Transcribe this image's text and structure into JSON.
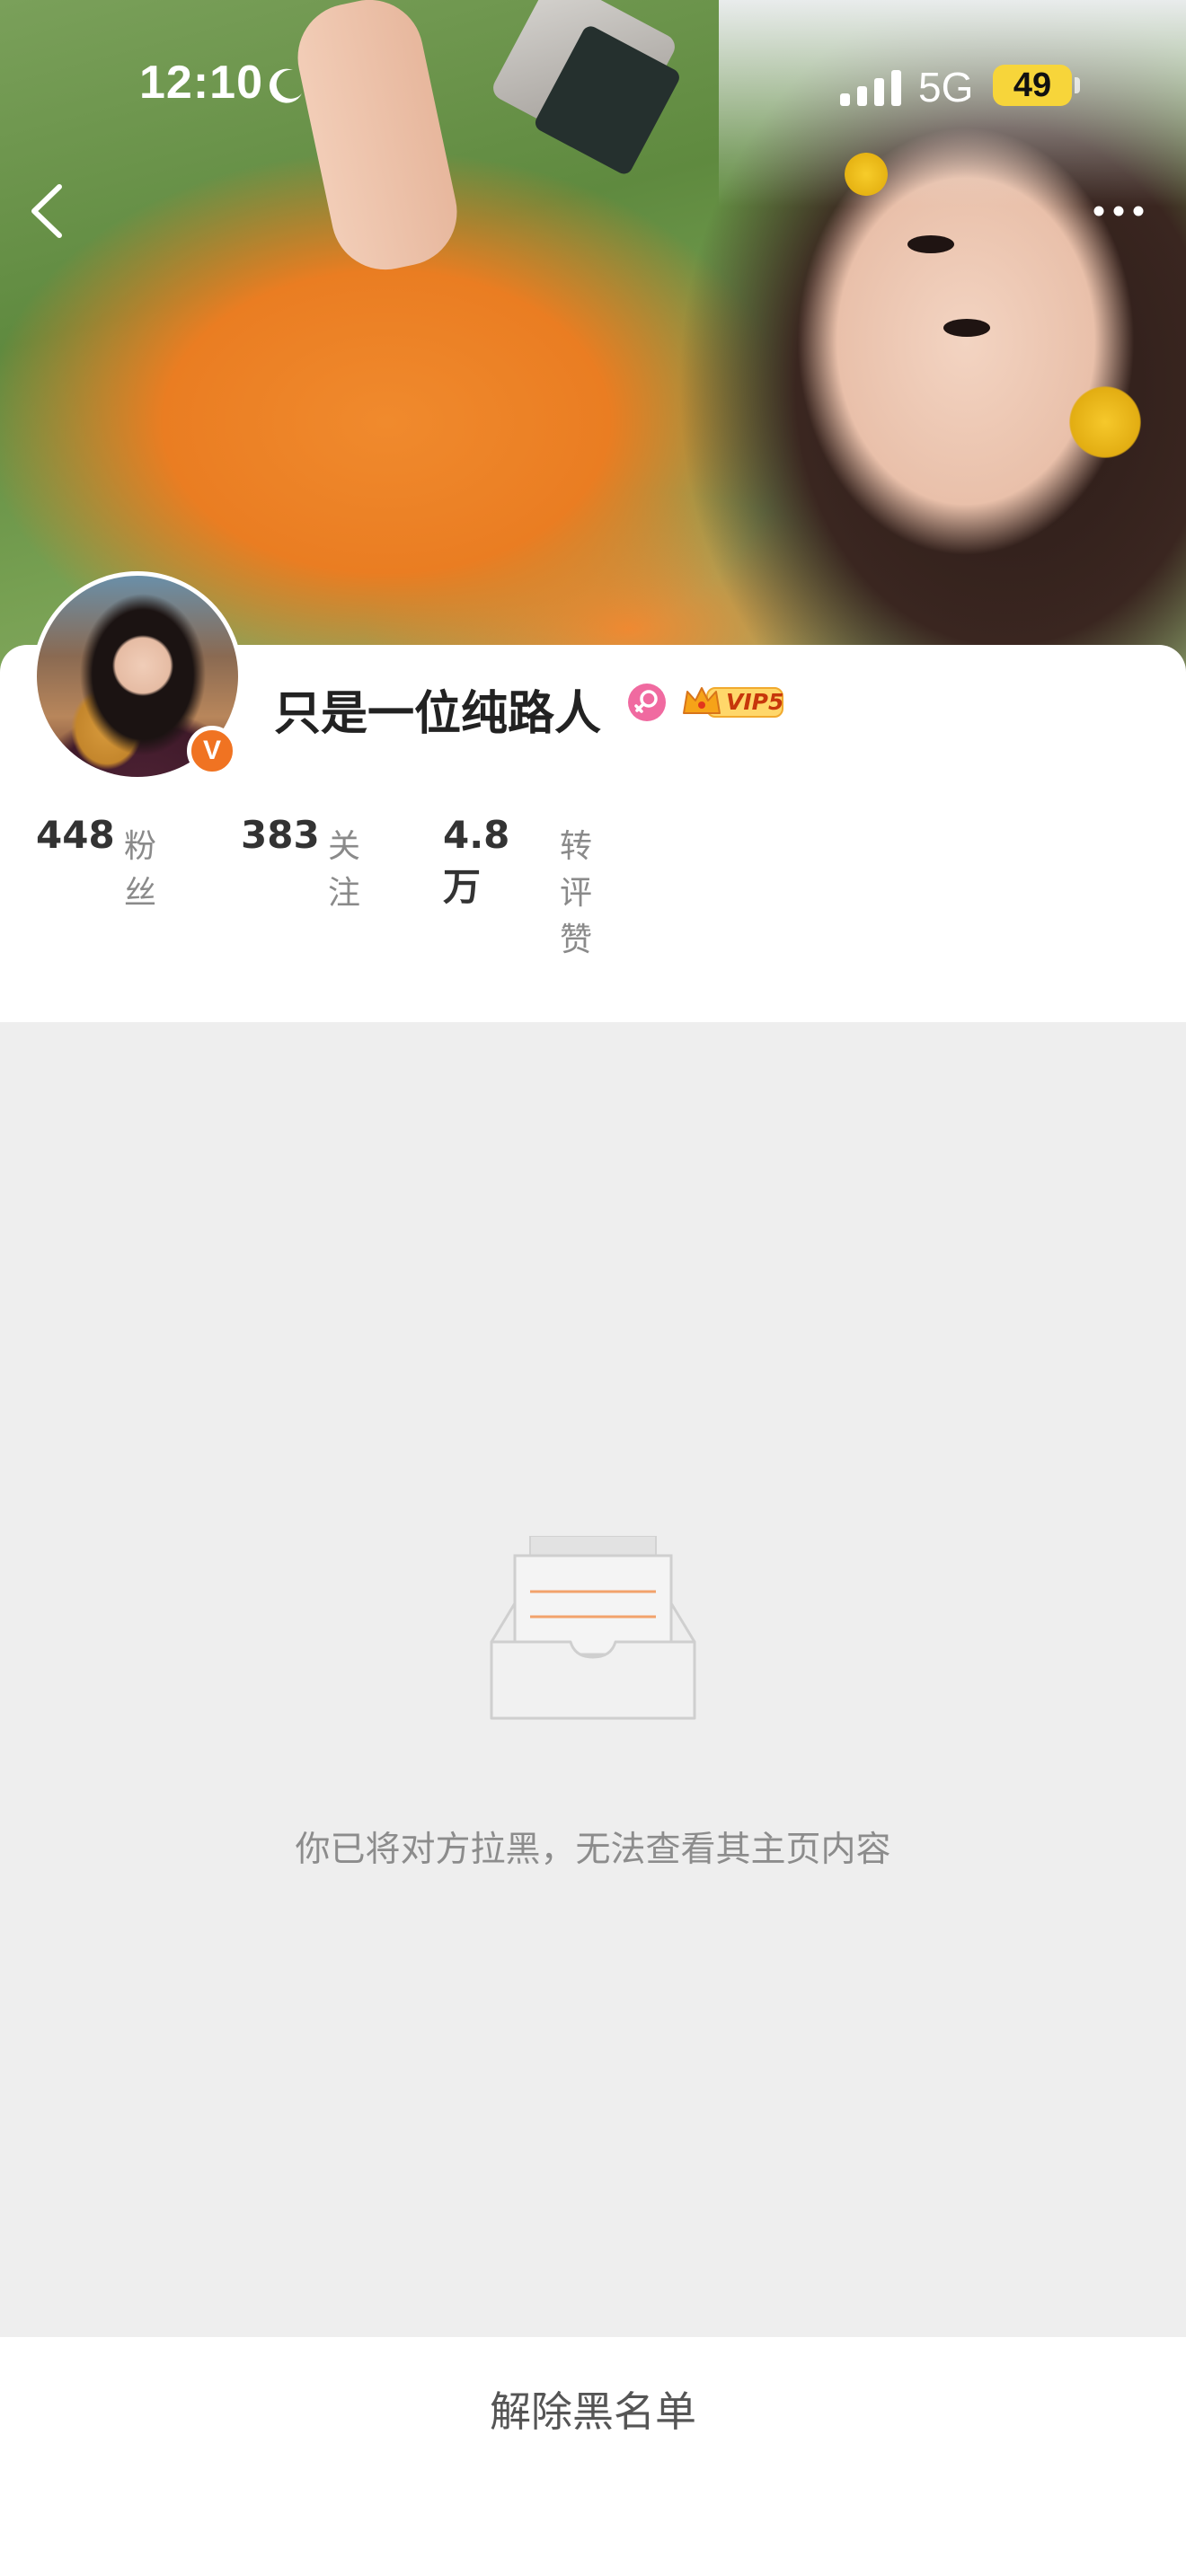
{
  "status_bar": {
    "time": "12:10",
    "network": "5G",
    "battery": "49",
    "icons": [
      "moon-icon",
      "signal-icon"
    ]
  },
  "nav": {
    "back_icon": "chevron-left-icon",
    "more_icon": "more-dots-icon"
  },
  "profile": {
    "username": "只是一位纯路人",
    "vip_label": "VIP5",
    "verified_mark": "V",
    "badges": [
      "female-icon",
      "vip-crown-icon",
      "verified-badge"
    ]
  },
  "stats": [
    {
      "value": "448",
      "label": "粉丝"
    },
    {
      "value": "383",
      "label": "关注"
    },
    {
      "value": "4.8万",
      "label": "转评赞"
    }
  ],
  "blocked": {
    "message": "你已将对方拉黑，无法查看其主页内容",
    "icon": "empty-inbox-icon"
  },
  "footer": {
    "unblock_label": "解除黑名单"
  },
  "colors": {
    "accent_orange": "#f07322",
    "battery_yellow": "#f7d53a",
    "gray_background": "#eeeeee",
    "muted_text": "#8c8c8c"
  }
}
